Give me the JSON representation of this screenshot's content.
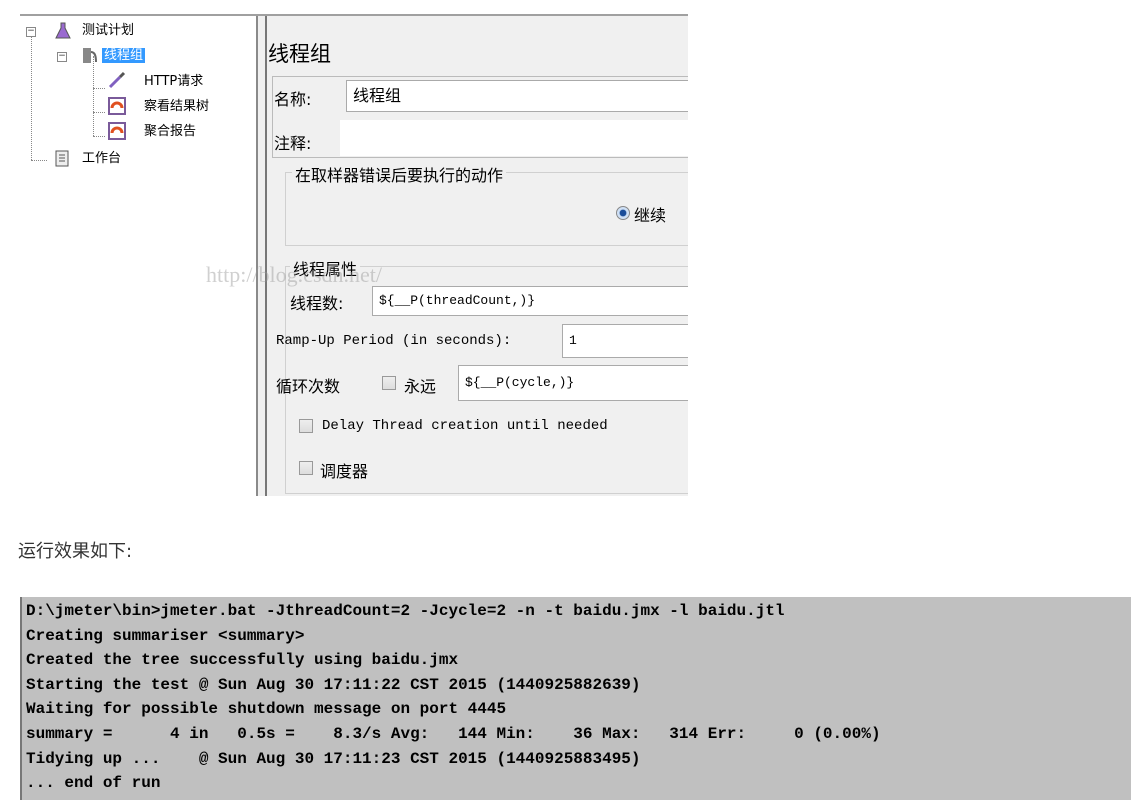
{
  "tree": {
    "items": [
      {
        "label": "测试计划",
        "icon": "test-plan-flask-icon",
        "expanded": true
      },
      {
        "label": "线程组",
        "icon": "thread-group-icon",
        "expanded": true,
        "selected": true
      },
      {
        "label": "HTTP请求",
        "icon": "http-sampler-pipette-icon"
      },
      {
        "label": "察看结果树",
        "icon": "listener-chart-icon"
      },
      {
        "label": "聚合报告",
        "icon": "listener-chart-icon"
      },
      {
        "label": "工作台",
        "icon": "workbench-clipboard-icon"
      }
    ]
  },
  "panel": {
    "title": "线程组",
    "name_label": "名称:",
    "name_value": "线程组",
    "comment_label": "注释:",
    "comment_value": "",
    "error_action_group": "在取样器错误后要执行的动作",
    "error_action_selected": "继续",
    "thread_props_group": "线程属性",
    "thread_count_label": "线程数:",
    "thread_count_value": "${__P(threadCount,)}",
    "rampup_label": "Ramp-Up Period (in seconds):",
    "rampup_value": "1",
    "loop_label": "循环次数",
    "forever_label": "永远",
    "forever_checked": false,
    "loop_value": "${__P(cycle,)}",
    "delay_label": "Delay Thread creation until needed",
    "delay_checked": false,
    "scheduler_label": "调度器",
    "scheduler_checked": false
  },
  "watermark": "http://blog.csdn.net/",
  "caption": "运行效果如下:",
  "console": {
    "lines": [
      "D:\\jmeter\\bin>jmeter.bat -JthreadCount=2 -Jcycle=2 -n -t baidu.jmx -l baidu.jtl",
      "Creating summariser <summary>",
      "Created the tree successfully using baidu.jmx",
      "Starting the test @ Sun Aug 30 17:11:22 CST 2015 (1440925882639)",
      "Waiting for possible shutdown message on port 4445",
      "summary =      4 in   0.5s =    8.3/s Avg:   144 Min:    36 Max:   314 Err:     0 (0.00%)",
      "Tidying up ...    @ Sun Aug 30 17:11:23 CST 2015 (1440925883495)",
      "... end of run"
    ]
  },
  "colors": {
    "selection": "#3399ff",
    "console_bg": "#c0c0c0",
    "panel_bg": "#f0f0f0"
  }
}
